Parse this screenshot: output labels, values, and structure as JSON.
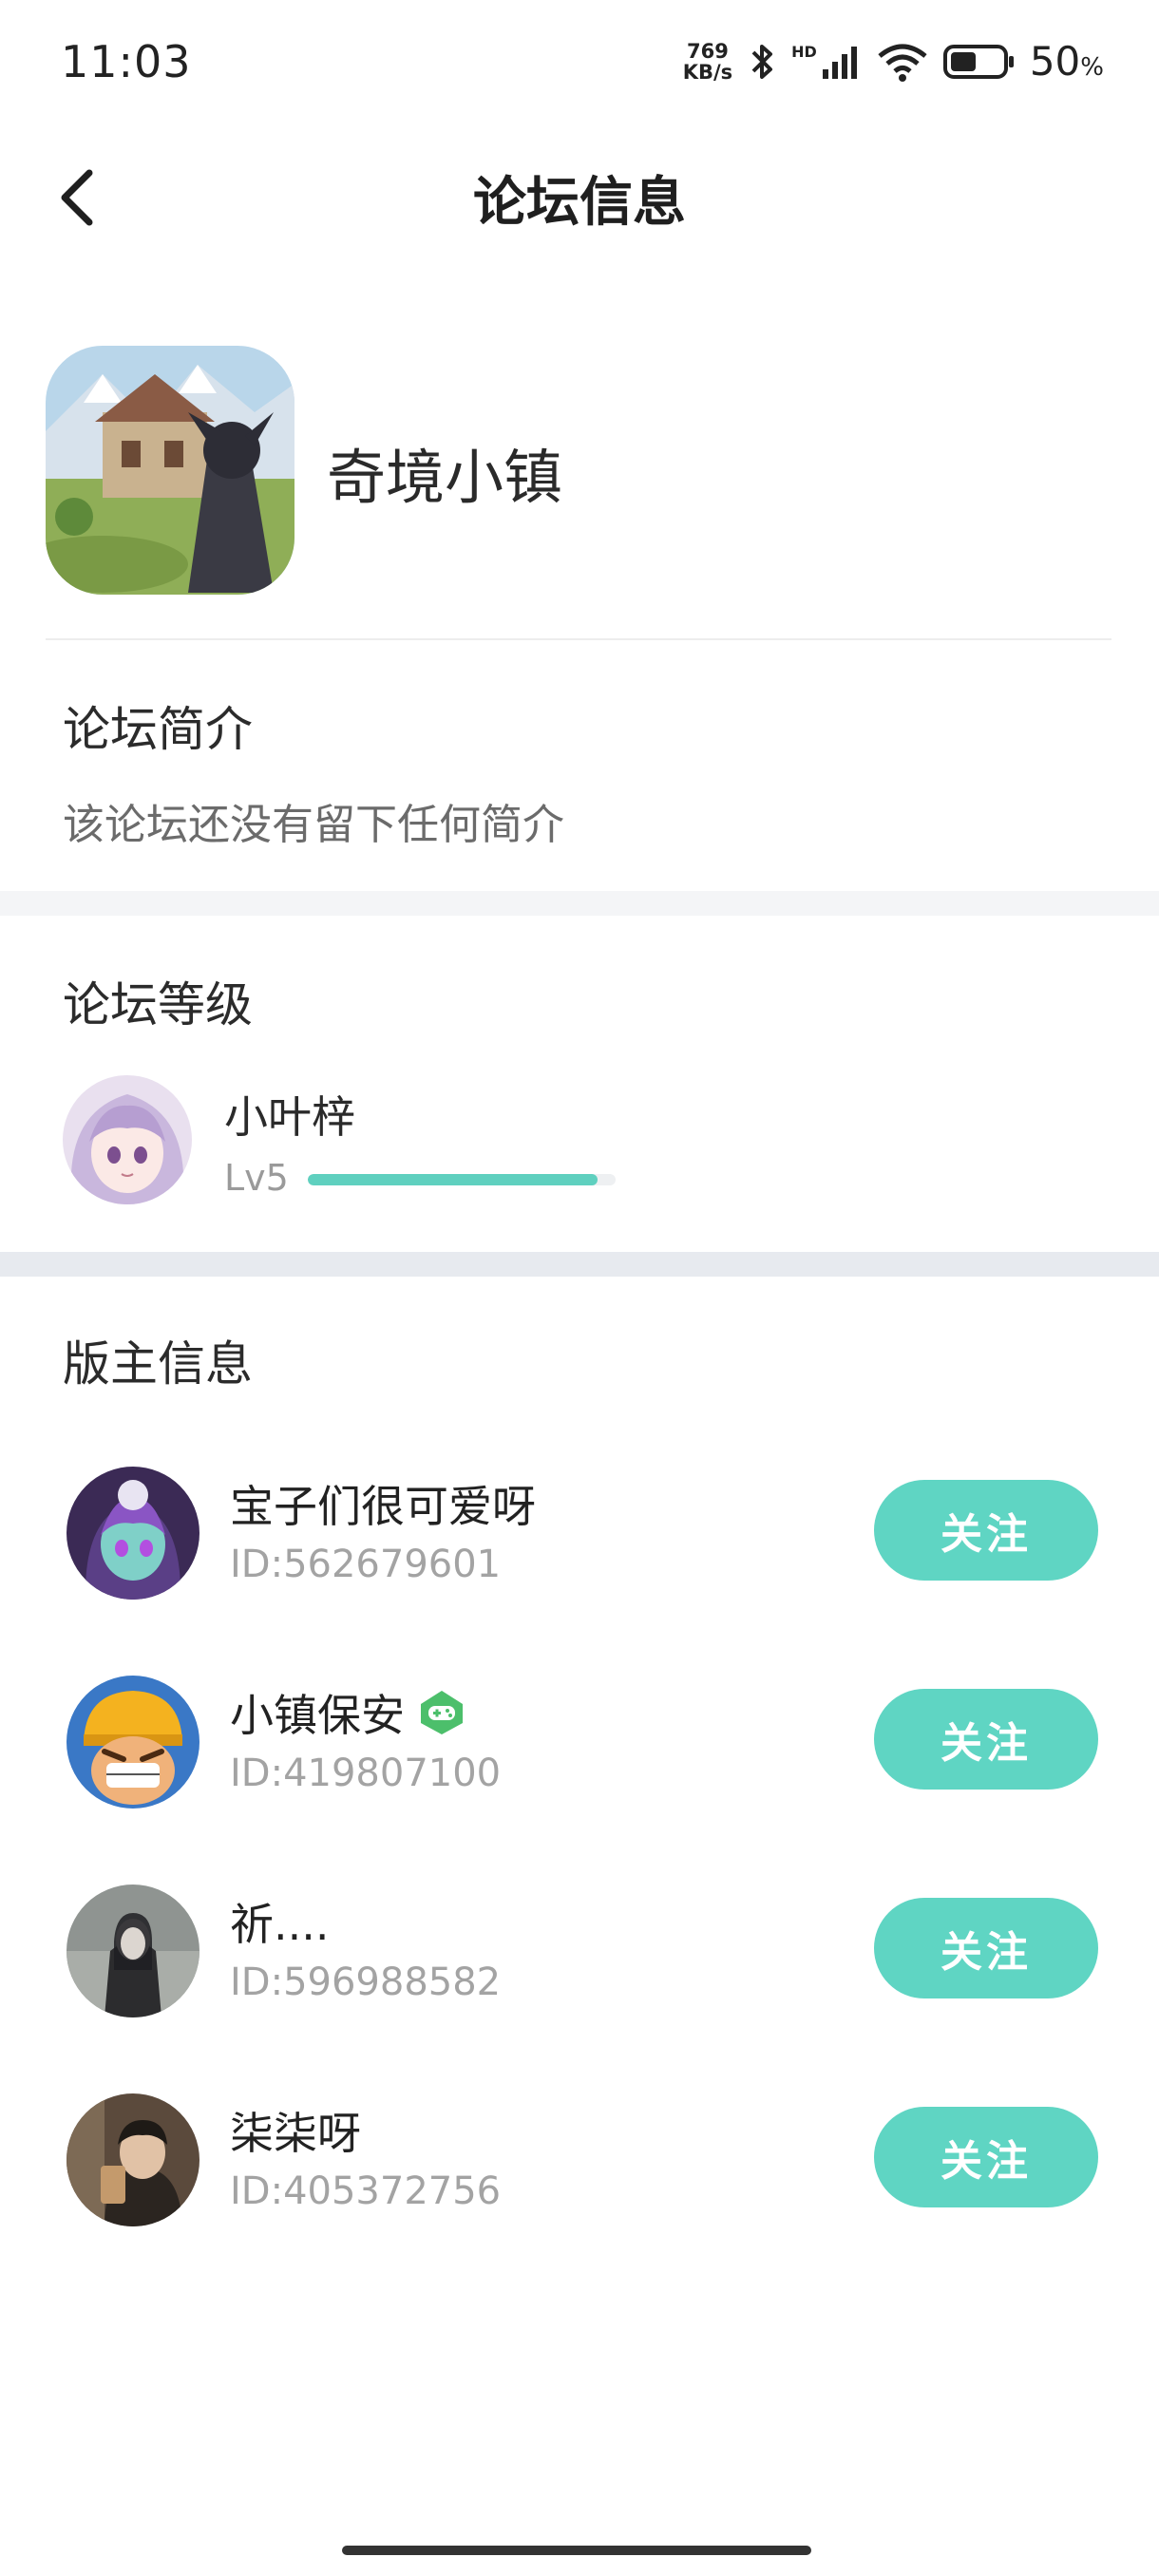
{
  "status_bar": {
    "time": "11:03",
    "net_speed_value": "769",
    "net_speed_unit": "KB/s",
    "hd_label": "HD",
    "battery_percent": "50",
    "battery_unit": "%",
    "battery_level": 0.5
  },
  "header": {
    "title": "论坛信息",
    "back_icon": "chevron-left-icon"
  },
  "forum": {
    "name": "奇境小镇",
    "intro_title": "论坛简介",
    "intro_text": "该论坛还没有留下任何简介"
  },
  "level": {
    "section_title": "论坛等级",
    "user_name": "小叶梓",
    "level_label": "Lv5",
    "progress": 0.94
  },
  "moderators": {
    "section_title": "版主信息",
    "follow_label": "关注",
    "items": [
      {
        "name": "宝子们很可爱呀",
        "id": "ID:562679601"
      },
      {
        "name": "小镇保安",
        "id": "ID:419807100",
        "badge": "gamepad-badge-icon"
      },
      {
        "name": "祈....",
        "id": "ID:596988582"
      },
      {
        "name": "柒柒呀",
        "id": "ID:405372756"
      }
    ]
  },
  "colors": {
    "accent": "#5fd5c3",
    "progress_fill": "#5fd0bf",
    "badge_green": "#4cbf6b"
  }
}
